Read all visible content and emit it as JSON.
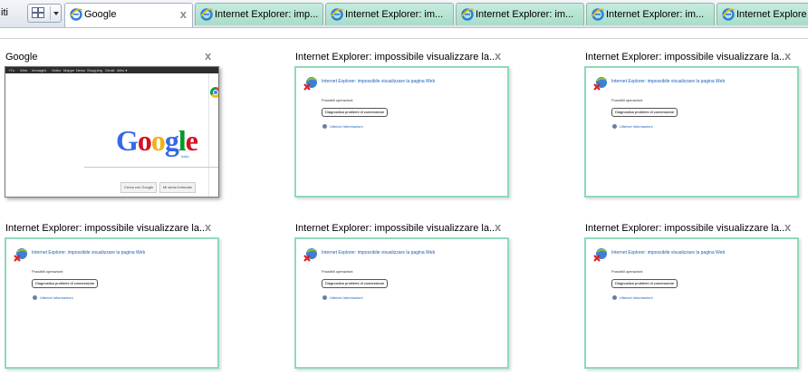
{
  "toolbar": {
    "left_label": "iti",
    "quick_tabs_icon": "quick-tabs-grid-icon"
  },
  "tabs": [
    {
      "label": "Google",
      "active": true,
      "close": "x"
    },
    {
      "label": "Internet Explorer: imp...",
      "active": false
    },
    {
      "label": "Internet Explorer: im...",
      "active": false
    },
    {
      "label": "Internet Explorer: im...",
      "active": false
    },
    {
      "label": "Internet Explorer: im...",
      "active": false
    },
    {
      "label": "Internet Explore",
      "active": false
    }
  ],
  "thumbnails": [
    {
      "title": "Google",
      "close": "x",
      "type": "google"
    },
    {
      "title": "Internet Explorer: impossibile visualizzare la...",
      "close": "x",
      "type": "error"
    },
    {
      "title": "Internet Explorer: impossibile visualizzare la...",
      "close": "x",
      "type": "error"
    },
    {
      "title": "Internet Explorer: impossibile visualizzare la...",
      "close": "x",
      "type": "error"
    },
    {
      "title": "Internet Explorer: impossibile visualizzare la...",
      "close": "x",
      "type": "error"
    },
    {
      "title": "Internet Explorer: impossibile visualizzare la...",
      "close": "x",
      "type": "error"
    }
  ],
  "google_preview": {
    "topbar": [
      "+Tu",
      "Web",
      "Immagini",
      "Video",
      "Mappe",
      "News",
      "Shopping",
      "Gmail",
      "Altro ▾"
    ],
    "logo": {
      "G": "G",
      "o1": "o",
      "o2": "o",
      "g": "g",
      "l": "l",
      "e": "e"
    },
    "subtitle": "Italia",
    "btn_search": "Cerca con Google",
    "btn_lucky": "Mi sento fortunato"
  },
  "error_preview": {
    "title": "Internet Explorer: impossibile visualizzare la pagina Web",
    "possible": "Possibili operazioni:",
    "diagnose": "Diagnostica problemi di connessione",
    "more_info": "Ulteriori informazioni"
  },
  "colors": {
    "tab_inactive": "#b2e2d0",
    "frame_border": "#8fd9b9",
    "link_blue": "#2160b5"
  }
}
